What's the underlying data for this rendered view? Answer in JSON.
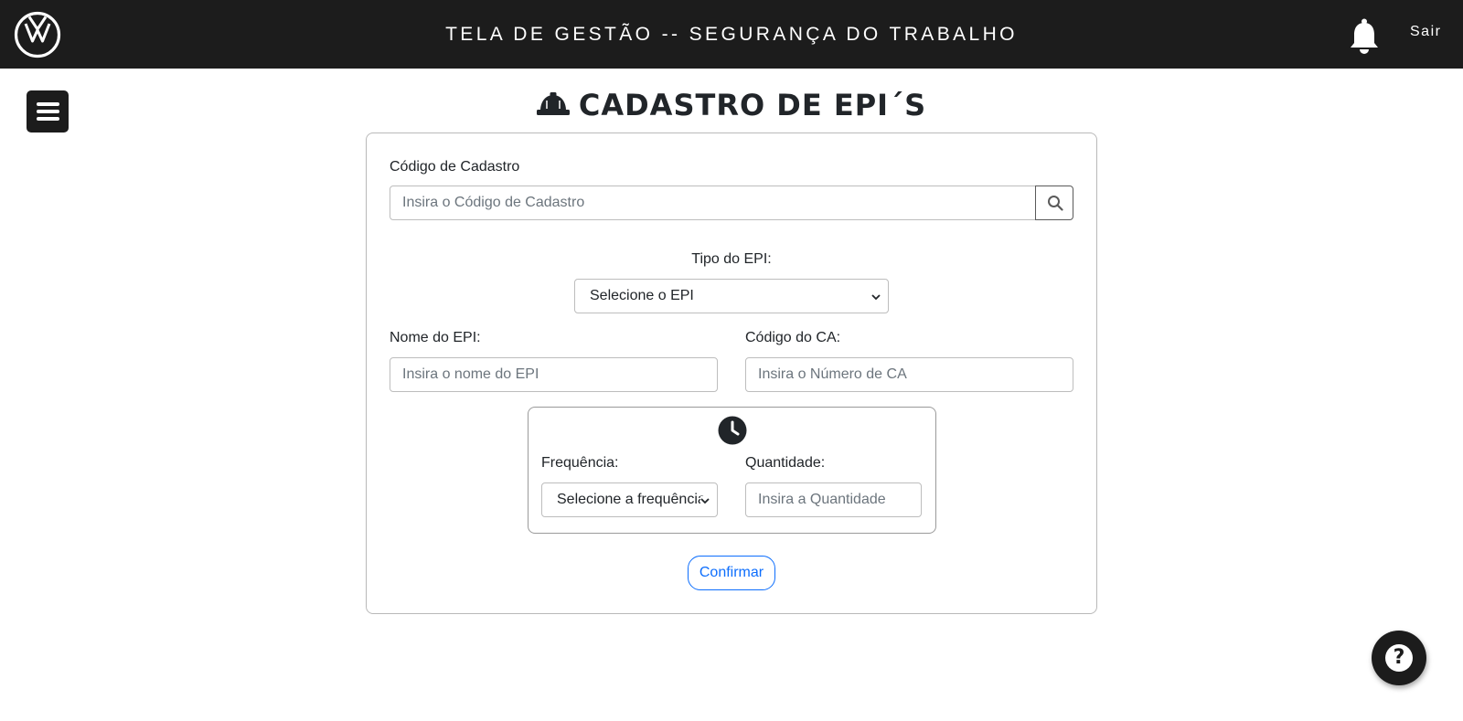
{
  "header": {
    "title": "TELA DE GESTÃO -- SEGURANÇA DO TRABALHO",
    "logout_label": "Sair",
    "logo_icon": "volkswagen-logo-icon",
    "notification_icon": "bell-icon",
    "background_color": "#1c1c1c"
  },
  "sidebar": {
    "menu_icon": "hamburger-menu-icon"
  },
  "page": {
    "heading": "CADASTRO DE EPI´S",
    "heading_icon": "hard-hat-icon"
  },
  "form": {
    "registration_code": {
      "label": "Código de Cadastro",
      "placeholder": "Insira o Código de Cadastro",
      "search_icon": "search-icon"
    },
    "epi_type": {
      "label": "Tipo do EPI:",
      "selected": "Selecione o EPI"
    },
    "epi_name": {
      "label": "Nome do EPI:",
      "placeholder": "Insira o nome do EPI"
    },
    "ca_code": {
      "label": "Código do CA:",
      "placeholder": "Insira o Número de CA"
    },
    "schedule": {
      "icon": "clock-icon",
      "frequency": {
        "label": "Frequência:",
        "selected": "Selecione a frequência"
      },
      "quantity": {
        "label": "Quantidade:",
        "placeholder": "Insira a Quantidade"
      }
    },
    "confirm_label": "Confirmar",
    "accent_color": "#0d6efd"
  },
  "help": {
    "label": "?",
    "icon": "help-icon"
  }
}
